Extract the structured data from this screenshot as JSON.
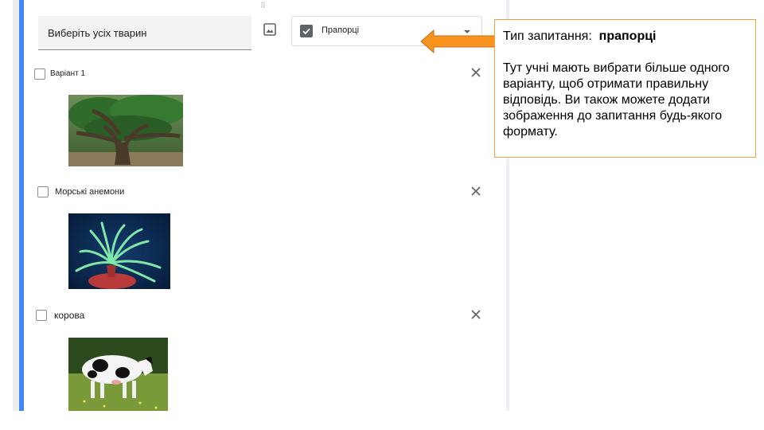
{
  "question": {
    "title": "Виберіть усіх тварин",
    "type_label": "Прапорці"
  },
  "options": [
    {
      "label": "Варіант 1",
      "image": "tree"
    },
    {
      "label": "Морські анемони",
      "image": "sea-anemone"
    },
    {
      "label": "корова",
      "image": "cow"
    }
  ],
  "callout": {
    "title_prefix": "Тип запитання:",
    "title_value": "прапорці",
    "body": "Тут учні мають вибрати більше одного варіанту, щоб отримати правильну відповідь. Ви також можете додати зображення до запитання  будь-якого формату."
  },
  "colors": {
    "accent": "#4285f4",
    "callout_border": "#f0a23c",
    "arrow_fill": "#f7931e"
  }
}
